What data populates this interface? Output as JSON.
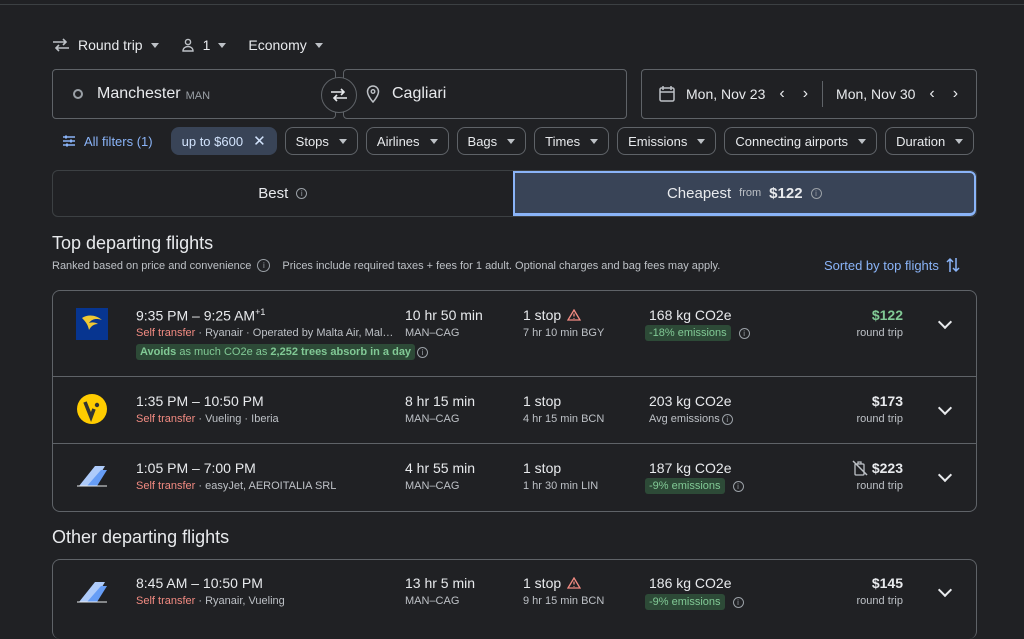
{
  "trip": {
    "type": "Round trip",
    "passengers": "1",
    "cabin": "Economy"
  },
  "search": {
    "origin": "Manchester",
    "origin_code": "MAN",
    "destination": "Cagliari",
    "depart": "Mon, Nov 23",
    "return": "Mon, Nov 30"
  },
  "filters": {
    "all": "All filters (1)",
    "price": "up to $600",
    "chips": [
      "Stops",
      "Airlines",
      "Bags",
      "Times",
      "Emissions",
      "Connecting airports",
      "Duration"
    ]
  },
  "tabs": {
    "best": "Best",
    "cheapest": "Cheapest",
    "cheapest_from": "from",
    "cheapest_price": "$122"
  },
  "top": {
    "title": "Top departing flights",
    "ranked": "Ranked based on price and convenience",
    "note": "Prices include required taxes + fees for 1 adult. Optional charges and bag fees may apply.",
    "sorted": "Sorted by top flights"
  },
  "flights": [
    {
      "time": "9:35 PM – 9:25 AM",
      "plus": "+1",
      "self": "Self transfer",
      "airline": "Ryanair · Operated by Malta Air, Mal…",
      "avoid_pre": "Avoids",
      "avoid_mid": " as much CO2e as ",
      "avoid_trees": "2,252 trees absorb in a day",
      "dur": "10 hr 50 min",
      "route": "MAN–CAG",
      "stops": "1 stop",
      "stopinfo": "7 hr 10 min BGY",
      "co2": "168 kg CO2e",
      "emis": "-18% emissions",
      "price": "$122",
      "rt": "round trip"
    },
    {
      "time": "1:35 PM – 10:50 PM",
      "self": "Self transfer",
      "airline": "Vueling · Iberia",
      "dur": "8 hr 15 min",
      "route": "MAN–CAG",
      "stops": "1 stop",
      "stopinfo": "4 hr 15 min BCN",
      "co2": "203 kg CO2e",
      "emis": "Avg emissions",
      "price": "$173",
      "rt": "round trip"
    },
    {
      "time": "1:05 PM – 7:00 PM",
      "self": "Self transfer",
      "airline": "easyJet, AEROITALIA SRL",
      "dur": "4 hr 55 min",
      "route": "MAN–CAG",
      "stops": "1 stop",
      "stopinfo": "1 hr 30 min LIN",
      "co2": "187 kg CO2e",
      "emis": "-9% emissions",
      "price": "$223",
      "rt": "round trip"
    }
  ],
  "other": {
    "title": "Other departing flights",
    "flights": [
      {
        "time": "8:45 AM – 10:50 PM",
        "self": "Self transfer",
        "airline": "Ryanair, Vueling",
        "dur": "13 hr 5 min",
        "route": "MAN–CAG",
        "stops": "1 stop",
        "stopinfo": "9 hr 15 min BCN",
        "co2": "186 kg CO2e",
        "emis": "-9% emissions",
        "price": "$145",
        "rt": "round trip"
      }
    ]
  },
  "colors": {
    "accent": "#8ab4f8",
    "green": "#81c995",
    "red": "#f28b82",
    "bg": "#202124"
  }
}
